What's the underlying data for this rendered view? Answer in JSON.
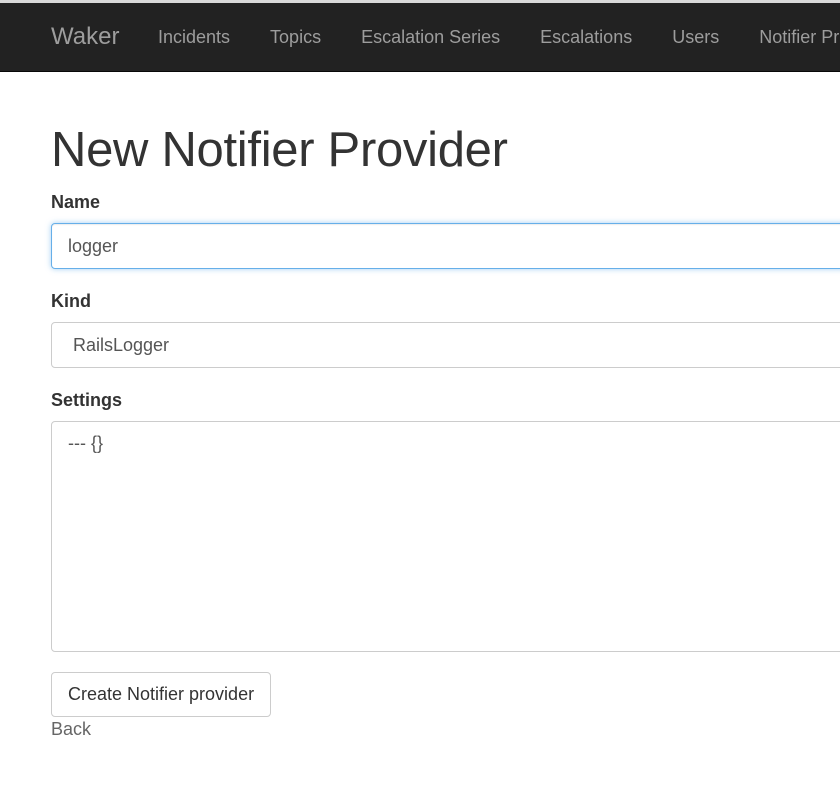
{
  "navbar": {
    "brand": "Waker",
    "links": [
      {
        "label": "Incidents"
      },
      {
        "label": "Topics"
      },
      {
        "label": "Escalation Series"
      },
      {
        "label": "Escalations"
      },
      {
        "label": "Users"
      },
      {
        "label": "Notifier Providers"
      }
    ]
  },
  "page": {
    "title": "New Notifier Provider"
  },
  "form": {
    "name": {
      "label": "Name",
      "value": "logger"
    },
    "kind": {
      "label": "Kind",
      "value": "RailsLogger"
    },
    "settings": {
      "label": "Settings",
      "value": "--- {}"
    },
    "submit_label": "Create Notifier provider"
  },
  "back_label": "Back",
  "colors": {
    "navbar_bg": "#222222",
    "nav_text": "#9d9d9d",
    "focus_border": "#66afe9"
  }
}
